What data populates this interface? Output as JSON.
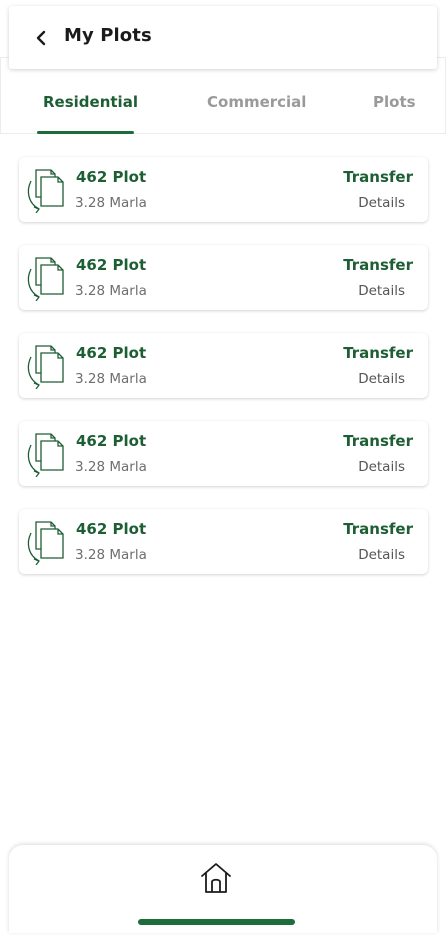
{
  "header": {
    "back_icon": "chevron-left-icon",
    "title": "My Plots"
  },
  "tabs": [
    {
      "label": "Residential",
      "active": true
    },
    {
      "label": "Commercial",
      "active": false
    },
    {
      "label": "Plots",
      "active": false
    }
  ],
  "plots": [
    {
      "name": "462 Plot",
      "size": "3.28 Marla",
      "transfer_label": "Transfer",
      "details_label": "Details",
      "icon": "documents-transfer-icon"
    },
    {
      "name": "462 Plot",
      "size": "3.28 Marla",
      "transfer_label": "Transfer",
      "details_label": "Details",
      "icon": "documents-transfer-icon"
    },
    {
      "name": "462 Plot",
      "size": "3.28 Marla",
      "transfer_label": "Transfer",
      "details_label": "Details",
      "icon": "documents-transfer-icon"
    },
    {
      "name": "462 Plot",
      "size": "3.28 Marla",
      "transfer_label": "Transfer",
      "details_label": "Details",
      "icon": "documents-transfer-icon"
    },
    {
      "name": "462 Plot",
      "size": "3.28 Marla",
      "transfer_label": "Transfer",
      "details_label": "Details",
      "icon": "documents-transfer-icon"
    }
  ],
  "bottom_nav": {
    "home_icon": "home-icon"
  },
  "colors": {
    "primary_green": "#1e5e34",
    "indicator_green": "#1e6b3c",
    "inactive_tab": "#9a9a9a",
    "muted_text": "#6f6f6f"
  }
}
